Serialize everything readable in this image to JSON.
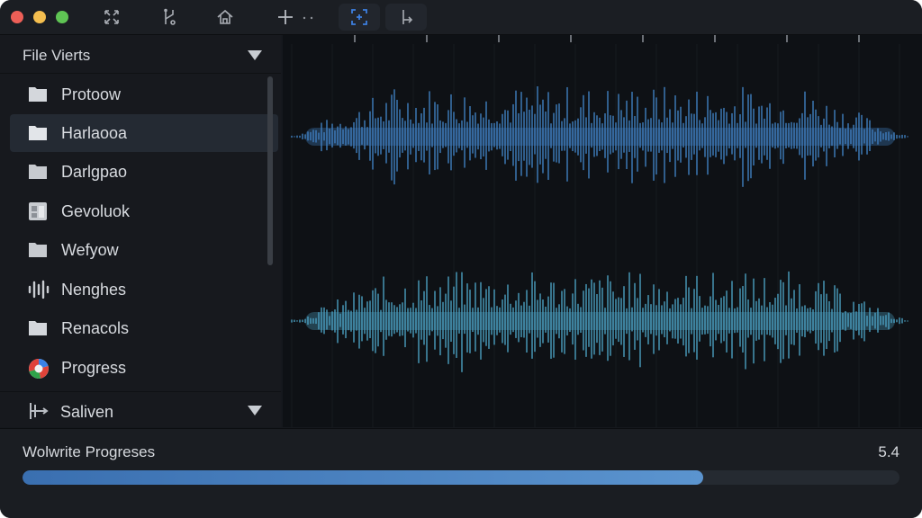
{
  "sidebar": {
    "title": "File Vierts",
    "items": [
      {
        "label": "Protoow",
        "icon": "folder-icon"
      },
      {
        "label": "Harlaooa",
        "icon": "folder-icon",
        "selected": true
      },
      {
        "label": "Darlgpao",
        "icon": "folder-icon"
      },
      {
        "label": "Gevoluok",
        "icon": "document-icon"
      },
      {
        "label": "Wefyow",
        "icon": "folder-icon"
      },
      {
        "label": "Nenghes",
        "icon": "audio-waveform-icon"
      },
      {
        "label": "Renacols",
        "icon": "folder-icon"
      },
      {
        "label": "Progress",
        "icon": "progress-pie-icon"
      }
    ],
    "footer": {
      "label": "Saliven",
      "icon": "audio-split-icon"
    }
  },
  "toolbar": {
    "icons": [
      "expand-arrows-icon",
      "merge-icon",
      "home-icon",
      "add-icon",
      "more-icon",
      "selection-icon",
      "split-icon"
    ]
  },
  "progress": {
    "label": "Wolwrite Progreses",
    "value_text": "5.4",
    "fraction": 0.776
  },
  "colors": {
    "accent": "#4f8bc9",
    "waveform_top": "#3f7fbf",
    "waveform_bottom": "#4a9fbf"
  }
}
